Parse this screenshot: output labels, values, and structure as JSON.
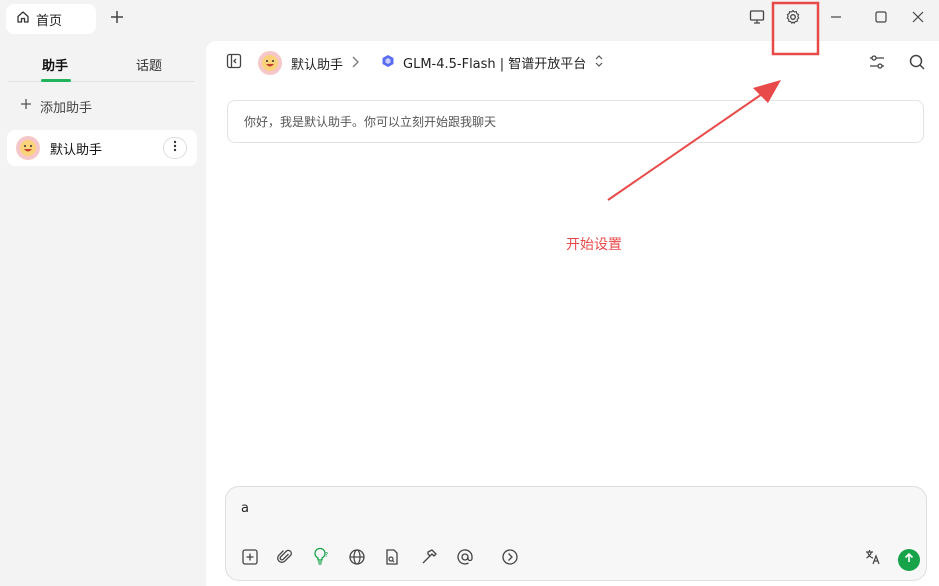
{
  "titlebar": {
    "tab_label": "首页"
  },
  "sidebar": {
    "tabs": [
      {
        "label": "助手"
      },
      {
        "label": "话题"
      }
    ],
    "add_assistant_label": "添加助手",
    "assistant_item": {
      "name": "默认助手"
    }
  },
  "main": {
    "assistant_name": "默认助手",
    "model_label": "GLM-4.5-Flash | 智谱开放平台",
    "welcome_text": "你好，我是默认助手。你可以立刻开始跟我聊天",
    "annotation_text": "开始设置"
  },
  "composer": {
    "value": "a"
  },
  "colors": {
    "accent_green": "#21b35b",
    "send_green": "#16a34a",
    "highlight_red": "#e84a4a",
    "model_icon": "#5b6cf0"
  },
  "icons": [
    "home-icon",
    "plus-icon",
    "monitor-icon",
    "gear-icon",
    "minimize-icon",
    "maximize-icon",
    "close-icon",
    "sidebar-toggle-icon",
    "chevron-right-icon",
    "model-logo-icon",
    "chevron-updown-icon",
    "sliders-icon",
    "search-icon",
    "more-vertical-icon",
    "new-topic-icon",
    "paperclip-icon",
    "lightbulb-icon",
    "globe-icon",
    "file-icon",
    "hammer-icon",
    "at-icon",
    "arrow-circle-icon",
    "translate-icon",
    "send-icon"
  ]
}
